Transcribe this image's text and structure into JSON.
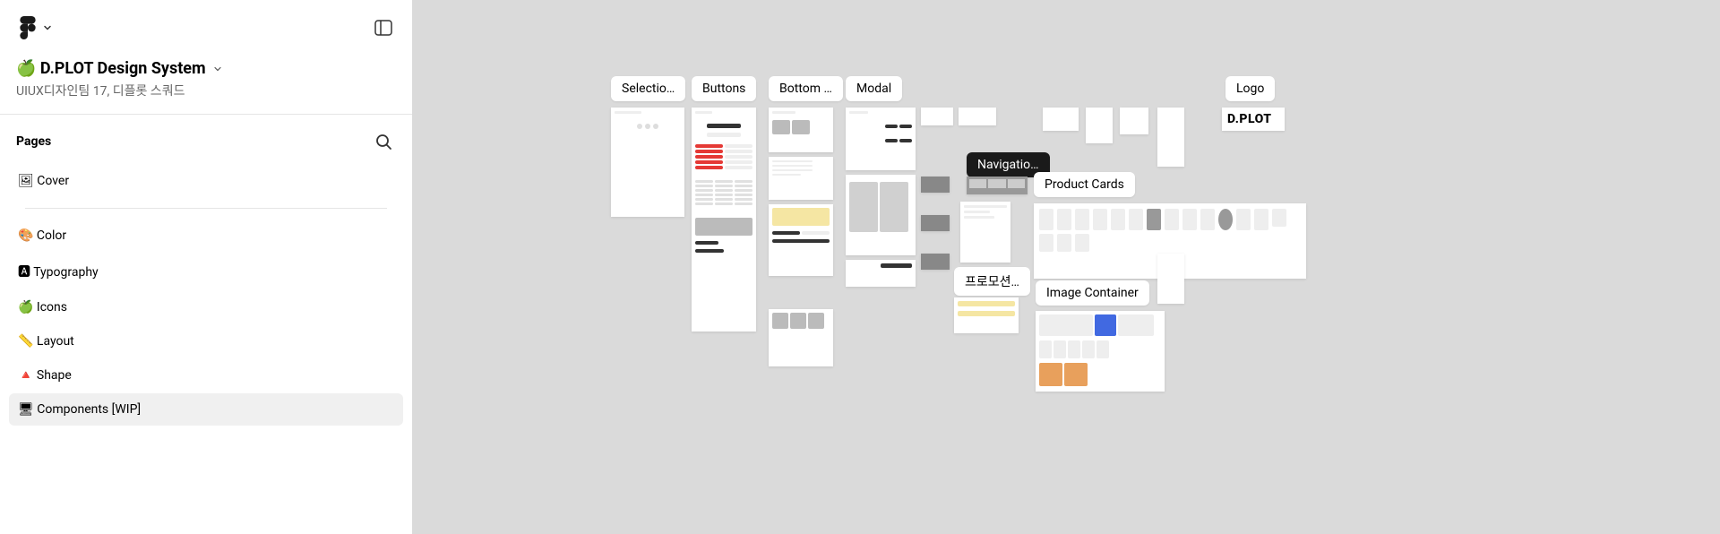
{
  "header": {
    "file_title": "🍏 D.PLOT Design System",
    "file_subtitle": "UIUX디자인팀 17, 디플롯 스쿼드"
  },
  "pages": {
    "label": "Pages",
    "items": [
      {
        "label": "🖼 Cover",
        "selected": false,
        "separator_after": true
      },
      {
        "label": "🎨 Color",
        "selected": false
      },
      {
        "label": "🅰 Typography",
        "selected": false
      },
      {
        "label": "🍏 Icons",
        "selected": false
      },
      {
        "label": "📏 Layout",
        "selected": false
      },
      {
        "label": "🔺 Shape",
        "selected": false
      },
      {
        "label": "🖥 Components [WIP]",
        "selected": true
      }
    ]
  },
  "canvas": {
    "frame_labels": {
      "selection": "Selectio…",
      "buttons": "Buttons",
      "bottom": "Bottom …",
      "modal": "Modal",
      "navigation": "Navigatio…",
      "product_cards": "Product Cards",
      "promotion": "프로모션…",
      "image_container": "Image Container",
      "logo": "Logo"
    },
    "logo_text": "D.PLOT"
  }
}
